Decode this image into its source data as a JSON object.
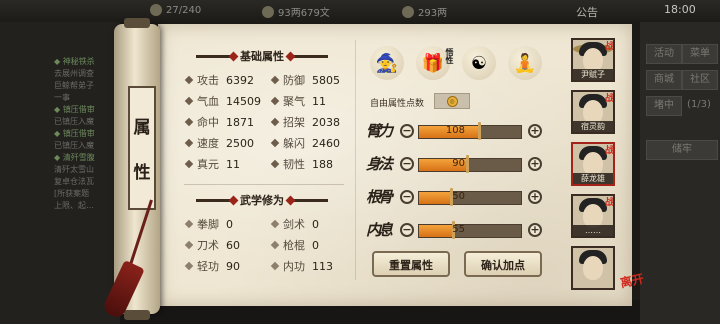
{
  "topbar": {
    "res1": "27/240",
    "res2": "93两679文",
    "res3": "293两",
    "notice": "公告",
    "clock": "18:00"
  },
  "log": [
    {
      "text": "◆ 神秘铁杀",
      "tone": "green"
    },
    {
      "text": "去展州调查",
      "tone": "gray"
    },
    {
      "text": "巨鲸帮弟子",
      "tone": "gray"
    },
    {
      "text": "一事",
      "tone": "gray"
    },
    {
      "text": "◆ 镇压借审",
      "tone": "green"
    },
    {
      "text": "已镇压入魔",
      "tone": "gray"
    },
    {
      "text": "◆ 镇压借审",
      "tone": "green"
    },
    {
      "text": "已镇压入魔",
      "tone": "gray"
    },
    {
      "text": "◆ 清歼雪腹",
      "tone": "green"
    },
    {
      "text": "清歼太雪山",
      "tone": "gray"
    },
    {
      "text": "复卓仓法瓦",
      "tone": "gray"
    },
    {
      "text": "[所获案题",
      "tone": "gray"
    },
    {
      "text": "上限、起…",
      "tone": "gray"
    }
  ],
  "right_menu": {
    "btn1": "活动",
    "btn2": "菜单",
    "btn3": "商城",
    "btn4": "社区",
    "btn5": "堵中",
    "count": "(1/3)",
    "btn6": "储牢"
  },
  "tab": {
    "char1": "属",
    "char2": "性"
  },
  "basic": {
    "title": "基础属性",
    "stats": [
      {
        "label": "攻击",
        "value": "6392"
      },
      {
        "label": "防御",
        "value": "5805"
      },
      {
        "label": "气血",
        "value": "14509"
      },
      {
        "label": "聚气",
        "value": "11"
      },
      {
        "label": "命中",
        "value": "1871"
      },
      {
        "label": "招架",
        "value": "2038"
      },
      {
        "label": "速度",
        "value": "2500"
      },
      {
        "label": "躲闪",
        "value": "2460"
      },
      {
        "label": "真元",
        "value": "11"
      },
      {
        "label": "韧性",
        "value": "188"
      }
    ]
  },
  "martial": {
    "title": "武学修为",
    "stats": [
      {
        "label": "拳脚",
        "value": "0"
      },
      {
        "label": "剑术",
        "value": "0"
      },
      {
        "label": "刀术",
        "value": "60"
      },
      {
        "label": "枪棍",
        "value": "0"
      },
      {
        "label": "轻功",
        "value": "90"
      },
      {
        "label": "内功",
        "value": "113"
      }
    ]
  },
  "figures": {
    "icon1": "scholar-figure-icon",
    "icon2": "treasure-bundle-icon",
    "icon2_tag": "悟性",
    "icon3": "yin-yang-icon",
    "icon4": "body-figure-icon"
  },
  "free_points": {
    "label": "自由属性点数",
    "icon": "coin-icon"
  },
  "attributes": [
    {
      "name": "臂力",
      "value": "108",
      "fill": 0.6
    },
    {
      "name": "身法",
      "value": "90",
      "fill": 0.48
    },
    {
      "name": "根骨",
      "value": "50",
      "fill": 0.32
    },
    {
      "name": "内息",
      "value": "55",
      "fill": 0.34
    }
  ],
  "buttons": {
    "reset": "重置属性",
    "confirm": "确认加点"
  },
  "portraits": [
    {
      "name": "尹赋子",
      "fight": "战"
    },
    {
      "name": "宿灵韵",
      "fight": "战"
    },
    {
      "name": "薛龙雄",
      "fight": "战"
    },
    {
      "name": "……",
      "fight": "战"
    },
    {
      "name": "",
      "fight": ""
    }
  ],
  "seal": "离开",
  "colors": {
    "accent": "#9a2418",
    "bar_fill": "#e2841f",
    "paper": "#efe7d3"
  }
}
